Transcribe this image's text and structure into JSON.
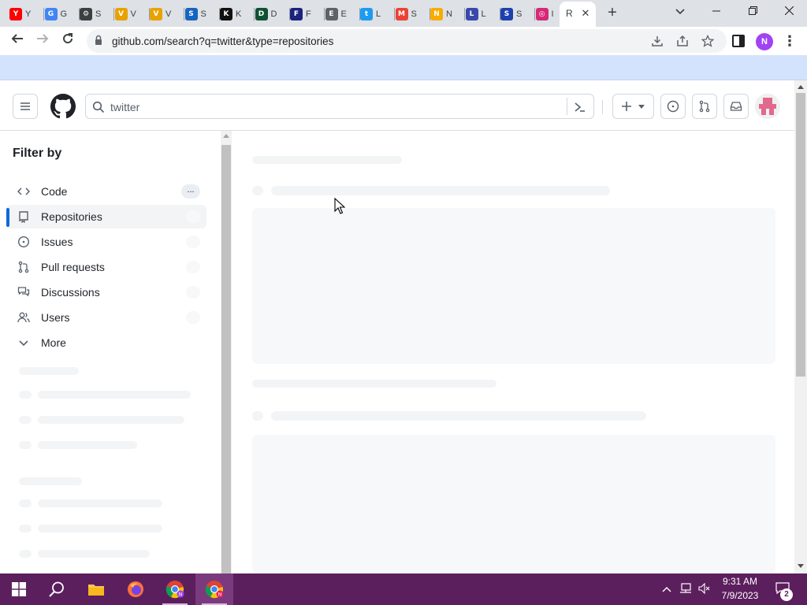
{
  "browser": {
    "tabs": [
      {
        "icon": "youtube-icon",
        "letter": "Y",
        "color": "#ff0000",
        "title": "Y"
      },
      {
        "icon": "google-icon",
        "letter": "G",
        "color": "#4285f4",
        "title": "G"
      },
      {
        "icon": "settings-icon",
        "letter": "⚙",
        "color": "#3c4043",
        "title": "S"
      },
      {
        "icon": "folder-icon",
        "letter": "V",
        "color": "#e8a200",
        "title": "V"
      },
      {
        "icon": "folder-icon",
        "letter": "V",
        "color": "#e8a200",
        "title": "V"
      },
      {
        "icon": "app-icon",
        "letter": "S",
        "color": "#1565c0",
        "title": "S"
      },
      {
        "icon": "kimi-icon",
        "letter": "K",
        "color": "#111111",
        "title": "K"
      },
      {
        "icon": "game-icon",
        "letter": "D",
        "color": "#0f5132",
        "title": "D"
      },
      {
        "icon": "app-icon",
        "letter": "F",
        "color": "#1a237e",
        "title": "F"
      },
      {
        "icon": "app-icon",
        "letter": "E",
        "color": "#5f6368",
        "title": "E"
      },
      {
        "icon": "twitter-icon",
        "letter": "t",
        "color": "#1d9bf0",
        "title": "L"
      },
      {
        "icon": "gmail-icon",
        "letter": "M",
        "color": "#ea4335",
        "title": "S"
      },
      {
        "icon": "bulb-icon",
        "letter": "N",
        "color": "#f9ab00",
        "title": "N"
      },
      {
        "icon": "app-icon",
        "letter": "L",
        "color": "#3949ab",
        "title": "L"
      },
      {
        "icon": "sonic-icon",
        "letter": "S",
        "color": "#1e40af",
        "title": "S"
      },
      {
        "icon": "instagram-icon",
        "letter": "◎",
        "color": "#d62976",
        "title": "I"
      }
    ],
    "active_tab": {
      "title": "R",
      "icon": "github-icon"
    },
    "url": "github.com/search?q=twitter&type=repositories",
    "profile_initial": "N"
  },
  "github": {
    "search_query": "twitter",
    "sidebar": {
      "title": "Filter by",
      "items": [
        {
          "label": "Code",
          "icon": "code-icon",
          "count": "..."
        },
        {
          "label": "Repositories",
          "icon": "repo-icon",
          "count": ""
        },
        {
          "label": "Issues",
          "icon": "issue-icon",
          "count": ""
        },
        {
          "label": "Pull requests",
          "icon": "pull-request-icon",
          "count": ""
        },
        {
          "label": "Discussions",
          "icon": "discussions-icon",
          "count": ""
        },
        {
          "label": "Users",
          "icon": "users-icon",
          "count": ""
        },
        {
          "label": "More",
          "icon": "chevron-down-icon",
          "count": ""
        }
      ]
    }
  },
  "taskbar": {
    "time": "9:31 AM",
    "date": "7/9/2023",
    "notification_count": "2"
  },
  "colors": {
    "accent": "#0969da",
    "bookmarks_bar": "#d3e3fd",
    "taskbar": "#5c1f5e"
  }
}
